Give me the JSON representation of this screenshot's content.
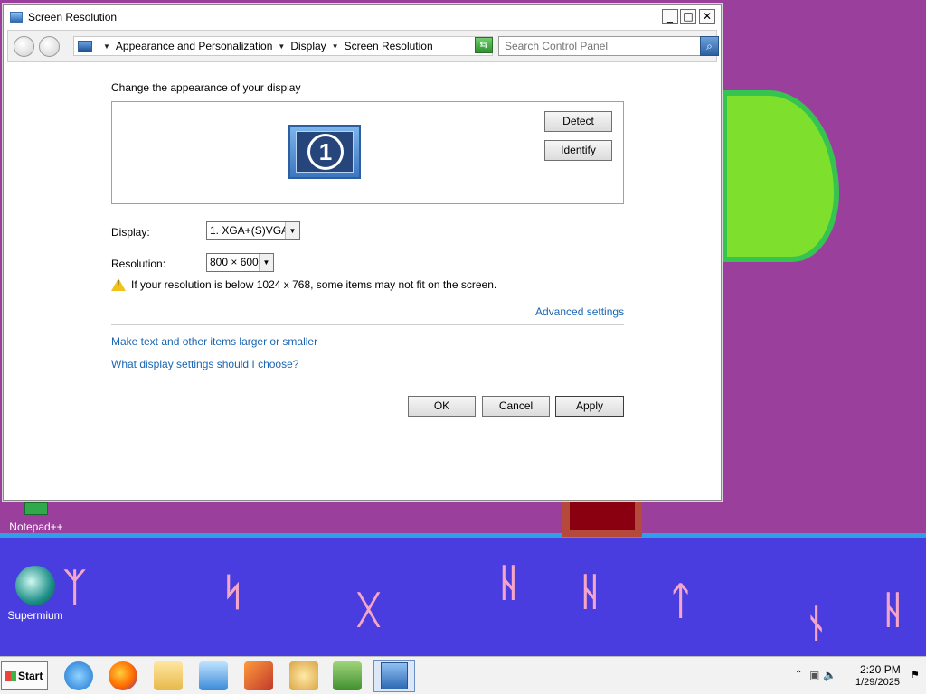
{
  "window": {
    "title": "Screen Resolution",
    "controls": {
      "minimize": "_",
      "maximize": "□",
      "close": "✕"
    }
  },
  "address": {
    "crumbs": [
      "Appearance and Personalization",
      "Display",
      "Screen Resolution"
    ],
    "search_placeholder": "Search Control Panel"
  },
  "main": {
    "heading": "Change the appearance of your display",
    "monitor_number": "1",
    "detect_label": "Detect",
    "identify_label": "Identify",
    "display_label": "Display:",
    "display_value": "1. XGA+(S)VGA",
    "resolution_label": "Resolution:",
    "resolution_value": "800 × 600",
    "warning_text": "If your resolution is below 1024 x 768, some items may not fit on the screen.",
    "advanced_link": "Advanced settings",
    "text_size_link": "Make text and other items larger or smaller",
    "help_link": "What display settings should I choose?",
    "ok_label": "OK",
    "cancel_label": "Cancel",
    "apply_label": "Apply"
  },
  "desktop": {
    "icons": [
      {
        "label": "Notepad++"
      },
      {
        "label": "Supermium"
      }
    ]
  },
  "taskbar": {
    "start_label": "Start",
    "apps": [
      "internet-explorer-icon",
      "firefox-icon",
      "file-explorer-icon",
      "media-player-icon",
      "paint-brush-icon",
      "paint-palette-icon",
      "network-users-icon",
      "display-settings-icon"
    ],
    "clock_time": "2:20 PM",
    "clock_date": "1/29/2025"
  },
  "colors": {
    "desktop_bg": "#9b3f9d",
    "link": "#1b65b3",
    "lake": "#4a3de0"
  }
}
